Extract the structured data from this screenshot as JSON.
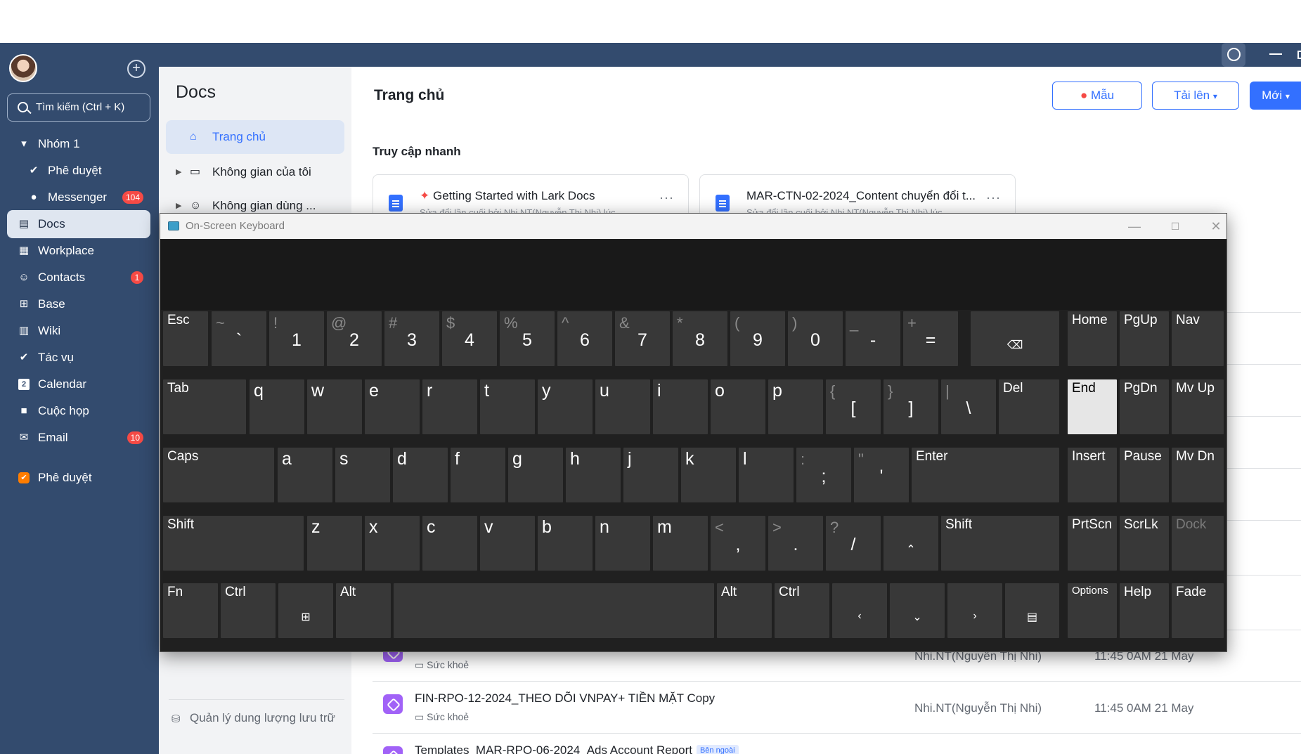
{
  "sidebar": {
    "search_label": "Tìm kiếm (Ctrl + K)",
    "items": [
      {
        "label": "Nhóm 1",
        "icon": "caret-down-icon",
        "top": 0
      },
      {
        "label": "Phê duyệt",
        "icon": "approval-icon"
      },
      {
        "label": "Messenger",
        "icon": "messenger-icon",
        "badge": "104"
      },
      {
        "label": "Docs",
        "icon": "docs-icon"
      },
      {
        "label": "Workplace",
        "icon": "workplace-icon"
      },
      {
        "label": "Contacts",
        "icon": "contacts-icon",
        "badge": "1"
      },
      {
        "label": "Base",
        "icon": "base-icon"
      },
      {
        "label": "Wiki",
        "icon": "wiki-icon"
      },
      {
        "label": "Tác vụ",
        "icon": "task-icon"
      },
      {
        "label": "Calendar",
        "icon": "calendar-icon",
        "calendar_day": "2"
      },
      {
        "label": "Cuộc họp",
        "icon": "meeting-icon"
      },
      {
        "label": "Email",
        "icon": "email-icon",
        "badge": "10"
      },
      {
        "label": "Phê duyệt",
        "icon": "approval-app-icon"
      }
    ]
  },
  "docs_panel": {
    "title": "Docs",
    "nav": [
      {
        "label": "Trang chủ",
        "icon": "home-icon"
      },
      {
        "label": "Không gian của tôi",
        "icon": "folder-icon"
      },
      {
        "label": "Không gian dùng ...",
        "icon": "shared-space-icon"
      }
    ],
    "storage_label": "Quản lý dung lượng lưu trữ"
  },
  "main": {
    "title": "Trang chủ",
    "buttons": {
      "template": "Mẫu",
      "upload": "Tải lên",
      "new": "Mới"
    },
    "quick_access_title": "Truy cập nhanh",
    "cards": [
      {
        "title": "Getting Started with Lark Docs",
        "subtitle": "Sửa đổi lần cuối bởi Nhi.NT(Nguyễn Thị Nhi) lúc ..."
      },
      {
        "title": "MAR-CTN-02-2024_Content chuyển đổi t...",
        "subtitle": "Sửa đổi lần cuối bởi Nhi.NT(Nguyễn Thị Nhi) lúc ..."
      }
    ],
    "files": [
      {
        "name": "",
        "location": "Sức khoẻ",
        "owner": "Nhi.NT(Nguyễn Thị Nhi)",
        "time": "11:45 0AM 21 May"
      },
      {
        "name": "FIN-RPO-12-2024_THEO DÕI VNPAY+ TIỀN MẶT Copy",
        "location": "Sức khoẻ",
        "owner": "Nhi.NT(Nguyễn Thị Nhi)",
        "time": "11:45 0AM 21 May"
      },
      {
        "name": "Templates_MAR-RPO-06-2024_Ads Account Report",
        "tag": "Bên ngoài",
        "location": "",
        "owner": "",
        "time": ""
      }
    ]
  },
  "osk": {
    "title": "On-Screen Keyboard",
    "row1": [
      [
        "~",
        "`"
      ],
      [
        "!",
        "1"
      ],
      [
        "@",
        "2"
      ],
      [
        "#",
        "3"
      ],
      [
        "$",
        "4"
      ],
      [
        "%",
        "5"
      ],
      [
        "^",
        "6"
      ],
      [
        "&",
        "7"
      ],
      [
        "*",
        "8"
      ],
      [
        "(",
        "9"
      ],
      [
        ")",
        "0"
      ],
      [
        "_",
        "-"
      ],
      [
        "+",
        "="
      ]
    ],
    "labels": {
      "esc": "Esc",
      "tab": "Tab",
      "caps": "Caps",
      "shift": "Shift",
      "fn": "Fn",
      "ctrl": "Ctrl",
      "alt": "Alt",
      "del": "Del",
      "enter": "Enter",
      "home": "Home",
      "pgup": "PgUp",
      "nav": "Nav",
      "end": "End",
      "pgdn": "PgDn",
      "mvup": "Mv Up",
      "insert": "Insert",
      "pause": "Pause",
      "mvdn": "Mv Dn",
      "prtscn": "PrtScn",
      "scrlk": "ScrLk",
      "dock": "Dock",
      "options": "Options",
      "help": "Help",
      "fade": "Fade"
    },
    "row2": [
      "q",
      "w",
      "e",
      "r",
      "t",
      "y",
      "u",
      "i",
      "o",
      "p"
    ],
    "row2_sym": [
      [
        "{",
        "["
      ],
      [
        "}",
        "]"
      ],
      [
        "|",
        "\\"
      ]
    ],
    "row3": [
      "a",
      "s",
      "d",
      "f",
      "g",
      "h",
      "j",
      "k",
      "l"
    ],
    "row3_sym": [
      [
        ":",
        ";"
      ],
      [
        "\"",
        "'"
      ]
    ],
    "row4": [
      "z",
      "x",
      "c",
      "v",
      "b",
      "n",
      "m"
    ],
    "row4_sym": [
      [
        "<",
        ","
      ],
      [
        ">",
        "."
      ],
      [
        "?",
        "/"
      ]
    ]
  }
}
